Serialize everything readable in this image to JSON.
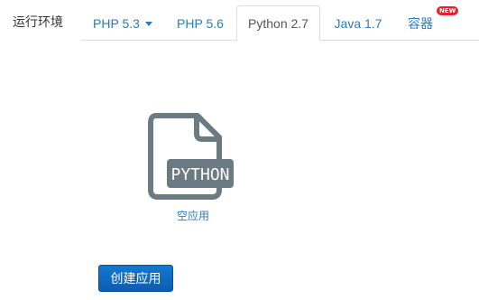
{
  "runtime": {
    "label": "运行环境",
    "tabs": [
      {
        "label": "PHP 5.3"
      },
      {
        "label": "PHP 5.6"
      },
      {
        "label": "Python 2.7"
      },
      {
        "label": "Java 1.7"
      },
      {
        "label": "容器"
      }
    ],
    "active_tab": "Python 2.7",
    "new_badge": "NEW"
  },
  "package": {
    "icon_text": "PYTHON",
    "name": "空应用"
  },
  "actions": {
    "create_label": "创建应用"
  },
  "colors": {
    "link": "#2a7bb8",
    "button": "#0c6ac4",
    "badge": "#e0252a",
    "icon": "#6b7a83"
  }
}
